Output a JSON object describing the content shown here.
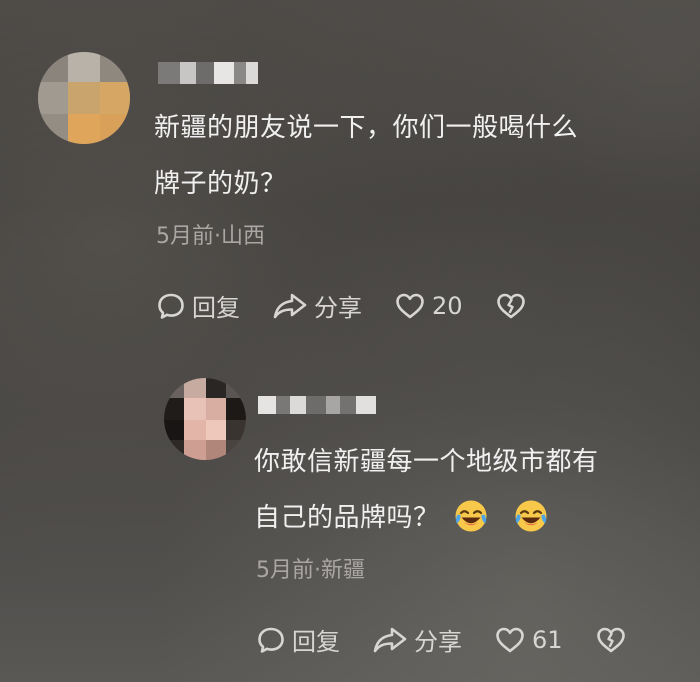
{
  "comments": [
    {
      "text_line1": "新疆的朋友说一下，你们一般喝什么",
      "text_line2": "牌子的奶？",
      "meta": "5月前·山西",
      "reply_label": "回复",
      "share_label": "分享",
      "like_count": "20"
    },
    {
      "text_line1": "你敢信新疆每一个地级市都有",
      "text_line2": "自己的品牌吗？",
      "emojis": [
        "laugh-cry-emoji",
        "laugh-cry-emoji"
      ],
      "meta": "5月前·新疆",
      "reply_label": "回复",
      "share_label": "分享",
      "like_count": "61"
    }
  ],
  "colors": {
    "text": "#f0f0f0",
    "meta": "#a9a6a3",
    "action": "#d8d6d3",
    "emoji": "#f7c84a"
  },
  "icons": [
    "comment-bubble-icon",
    "share-arrow-icon",
    "heart-icon",
    "dislike-heart-icon"
  ]
}
